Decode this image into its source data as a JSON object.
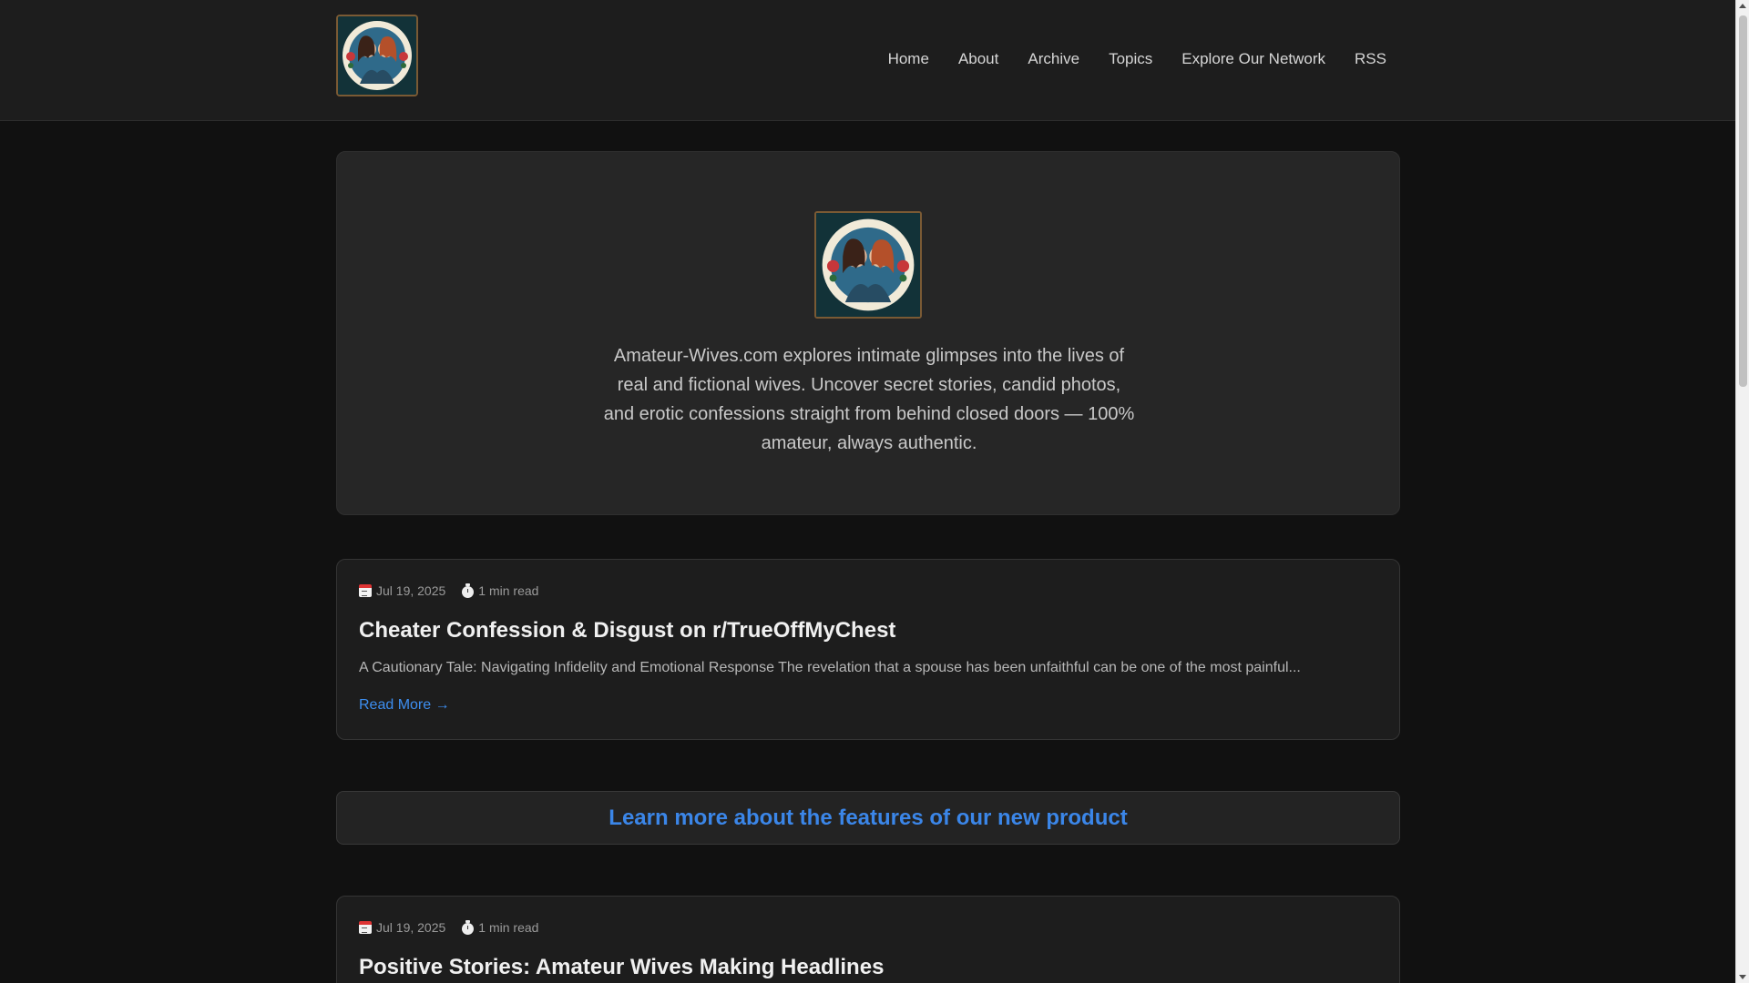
{
  "header": {
    "logo_alt": "Amateur-Wives.com logo",
    "nav": [
      {
        "label": "Home"
      },
      {
        "label": "About"
      },
      {
        "label": "Archive"
      },
      {
        "label": "Topics"
      },
      {
        "label": "Explore Our Network"
      },
      {
        "label": "RSS"
      }
    ]
  },
  "hero": {
    "description": "Amateur-Wives.com explores intimate glimpses into the lives of real and fictional wives. Uncover secret stories, candid photos, and erotic confessions straight from behind closed doors — 100% amateur, always authentic."
  },
  "posts": [
    {
      "date": "Jul 19, 2025",
      "read_time": "1 min read",
      "title": "Cheater Confession & Disgust on r/TrueOffMyChest",
      "excerpt": "A Cautionary Tale: Navigating Infidelity and Emotional Response The revelation that a spouse has been unfaithful can be one of the most painful...",
      "read_more": "Read More →"
    },
    {
      "date": "Jul 19, 2025",
      "read_time": "1 min read",
      "title": "Positive Stories: Amateur Wives Making Headlines"
    }
  ],
  "promo": {
    "label": "Learn more about the features of our new product"
  },
  "colors": {
    "background": "#111111",
    "header_bg": "#1d1d1d",
    "card_bg": "#1d1d1d",
    "hero_bg": "#262626",
    "link": "#3b86e8"
  }
}
